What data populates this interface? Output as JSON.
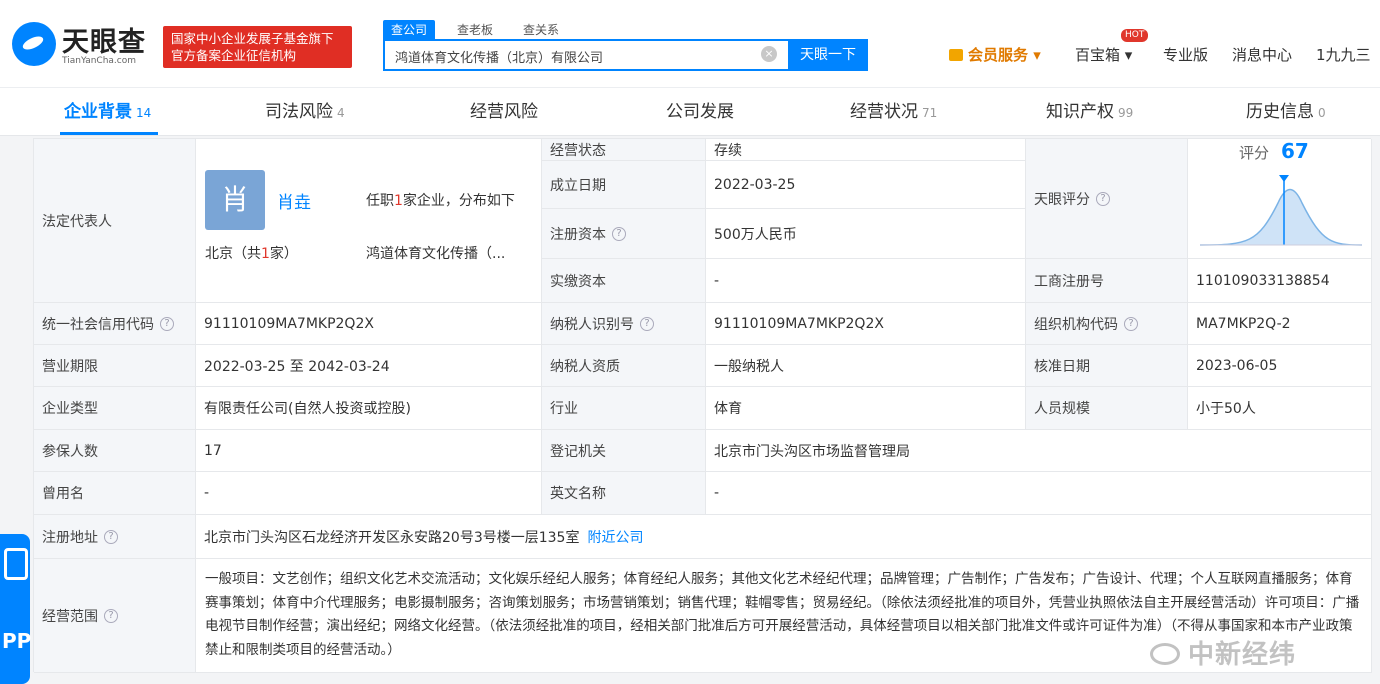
{
  "header": {
    "logo_text": "天眼查",
    "logo_sub": "TianYanCha.com",
    "gov_badge_line1": "国家中小企业发展子基金旗下",
    "gov_badge_line2": "官方备案企业征信机构",
    "search_tabs": [
      "查公司",
      "查老板",
      "查关系"
    ],
    "search_value": "鸿道体育文化传播（北京）有限公司",
    "search_button": "天眼一下",
    "nav": {
      "vip": "会员服务",
      "baobox": "百宝箱",
      "hot": "HOT",
      "pro": "专业版",
      "messages": "消息中心",
      "user": "1九九三"
    }
  },
  "tabs": [
    {
      "label": "企业背景",
      "count": "14"
    },
    {
      "label": "司法风险",
      "count": "4"
    },
    {
      "label": "经营风险",
      "count": ""
    },
    {
      "label": "公司发展",
      "count": ""
    },
    {
      "label": "经营状况",
      "count": "71"
    },
    {
      "label": "知识产权",
      "count": "99"
    },
    {
      "label": "历史信息",
      "count": "0"
    }
  ],
  "rep": {
    "label": "法定代表人",
    "avatar_char": "肖",
    "name": "肖垚",
    "info_pre": "任职",
    "info_num": "1",
    "info_post": "家企业，分布如下",
    "city_pre": "北京（共",
    "city_num": "1",
    "city_post": "家）",
    "company": "鸿道体育文化传播（..."
  },
  "rows": {
    "status_label": "经营状态",
    "status": "存续",
    "founded_label": "成立日期",
    "founded": "2022-03-25",
    "capital_label": "注册资本",
    "capital": "500万人民币",
    "paid_label": "实缴资本",
    "paid": "-",
    "score_label": "天眼评分",
    "score_text": "评分",
    "score": "67",
    "regno_label": "工商注册号",
    "regno": "110109033138854",
    "credit_label": "统一社会信用代码",
    "credit": "91110109MA7MKP2Q2X",
    "tax_label": "纳税人识别号",
    "tax": "91110109MA7MKP2Q2X",
    "org_label": "组织机构代码",
    "org": "MA7MKP2Q-2",
    "term_label": "营业期限",
    "term": "2022-03-25 至 2042-03-24",
    "taxq_label": "纳税人资质",
    "taxq": "一般纳税人",
    "approve_label": "核准日期",
    "approve": "2023-06-05",
    "type_label": "企业类型",
    "type": "有限责任公司(自然人投资或控股)",
    "industry_label": "行业",
    "industry": "体育",
    "staff_label": "人员规模",
    "staff": "小于50人",
    "insured_label": "参保人数",
    "insured": "17",
    "regorg_label": "登记机关",
    "regorg": "北京市门头沟区市场监督管理局",
    "former_label": "曾用名",
    "former": "-",
    "en_label": "英文名称",
    "en": "-",
    "addr_label": "注册地址",
    "addr": "北京市门头沟区石龙经济开发区永安路20号3号楼一层135室",
    "addr_link": "附近公司",
    "scope_label": "经营范围",
    "scope": "一般项目：文艺创作；组织文化艺术交流活动；文化娱乐经纪人服务；体育经纪人服务；其他文化艺术经纪代理；品牌管理；广告制作；广告发布；广告设计、代理；个人互联网直播服务；体育赛事策划；体育中介代理服务；电影摄制服务；咨询策划服务；市场营销策划；销售代理；鞋帽零售；贸易经纪。（除依法须经批准的项目外，凭营业执照依法自主开展经营活动）许可项目：广播电视节目制作经营；演出经纪；网络文化经营。（依法须经批准的项目，经相关部门批准后方可开展经营活动，具体经营项目以相关部门批准文件或许可证件为准）（不得从事国家和本市产业政策禁止和限制类项目的经营活动。）"
  },
  "side_app_text": "PP",
  "watermark": "中新经纬"
}
